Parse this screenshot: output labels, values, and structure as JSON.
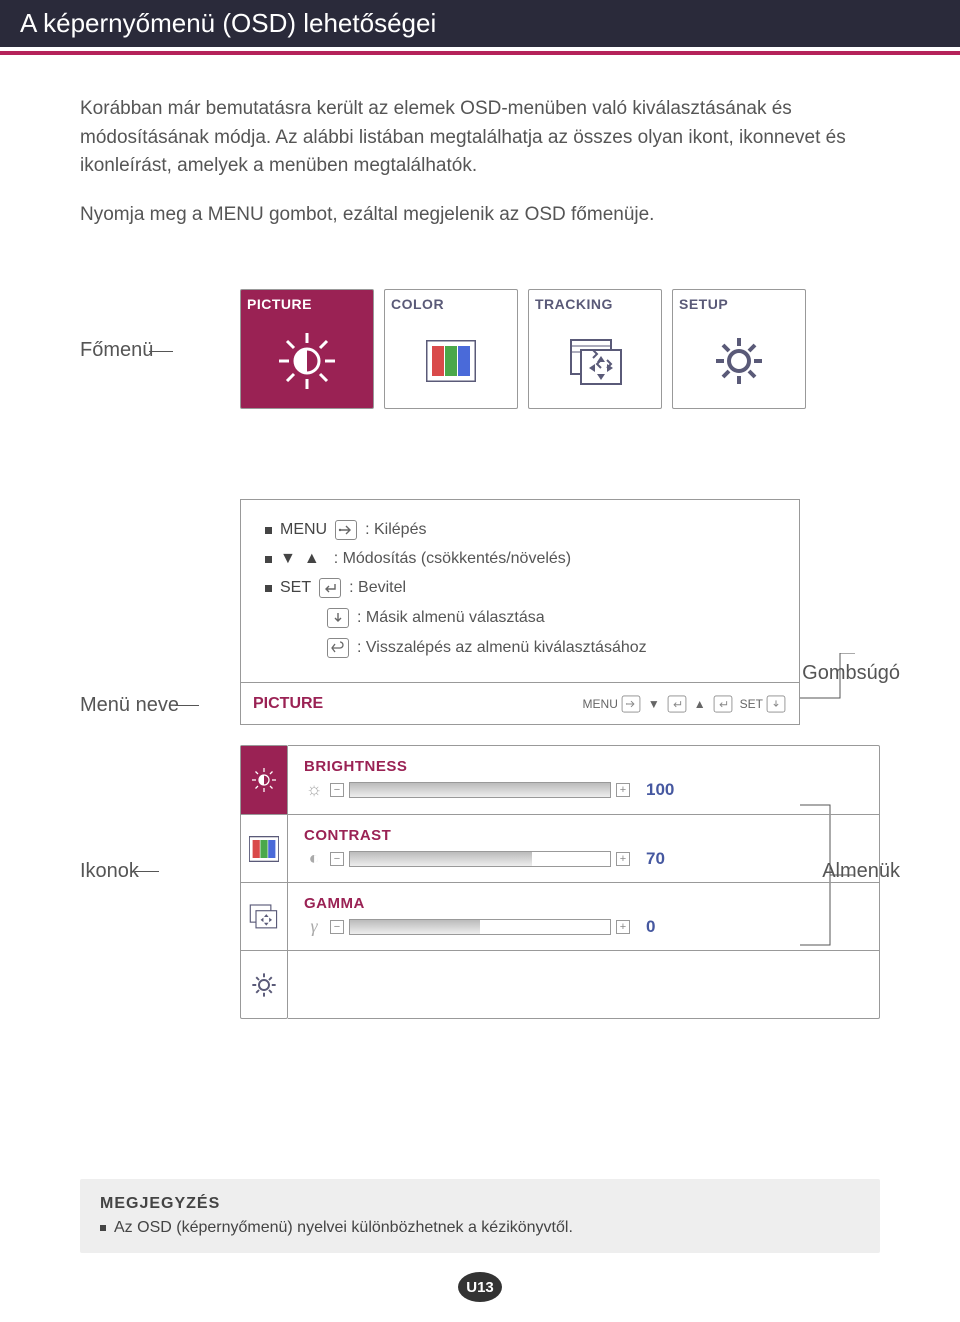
{
  "header": {
    "title": "A képernyőmenü (OSD) lehetőségei"
  },
  "intro": {
    "p1": "Korábban már bemutatásra került az elemek OSD-menüben való kiválasztásának és módosításának módja. Az alábbi listában megtalálhatja az összes olyan ikont, ikonnevet és ikonleírást, amelyek a menüben megtalálhatók.",
    "p2": "Nyomja meg a MENU gombot, ezáltal megjelenik az OSD főmenüje."
  },
  "labels": {
    "fomenu": "Főmenü",
    "menuneve": "Menü neve",
    "gombsugo": "Gombsúgó",
    "ikonok": "Ikonok",
    "almenuk": "Almenük"
  },
  "menuTabs": {
    "picture": "PICTURE",
    "color": "COLOR",
    "tracking": "TRACKING",
    "setup": "SETUP"
  },
  "legend": {
    "menu": "MENU",
    "menu_desc": ": Kilépés",
    "arrows_desc": ": Módosítás (csökkentés/növelés)",
    "set": "SET",
    "set_desc": ": Bevitel",
    "down_desc": ": Másik almenü választása",
    "back_desc": ": Visszalépés az almenü kiválasztásához",
    "footer_title": "PICTURE",
    "footer_menu": "MENU",
    "footer_set": "SET"
  },
  "sliders": {
    "brightness": {
      "name": "BRIGHTNESS",
      "value": "100",
      "fill": 100
    },
    "contrast": {
      "name": "CONTRAST",
      "value": "70",
      "fill": 70
    },
    "gamma": {
      "name": "GAMMA",
      "value": "0",
      "fill": 50
    }
  },
  "note": {
    "title": "MEGJEGYZÉS",
    "text": "Az OSD (képernyőmenü) nyelvei különbözhetnek a kézikönyvtől."
  },
  "page": "U13"
}
